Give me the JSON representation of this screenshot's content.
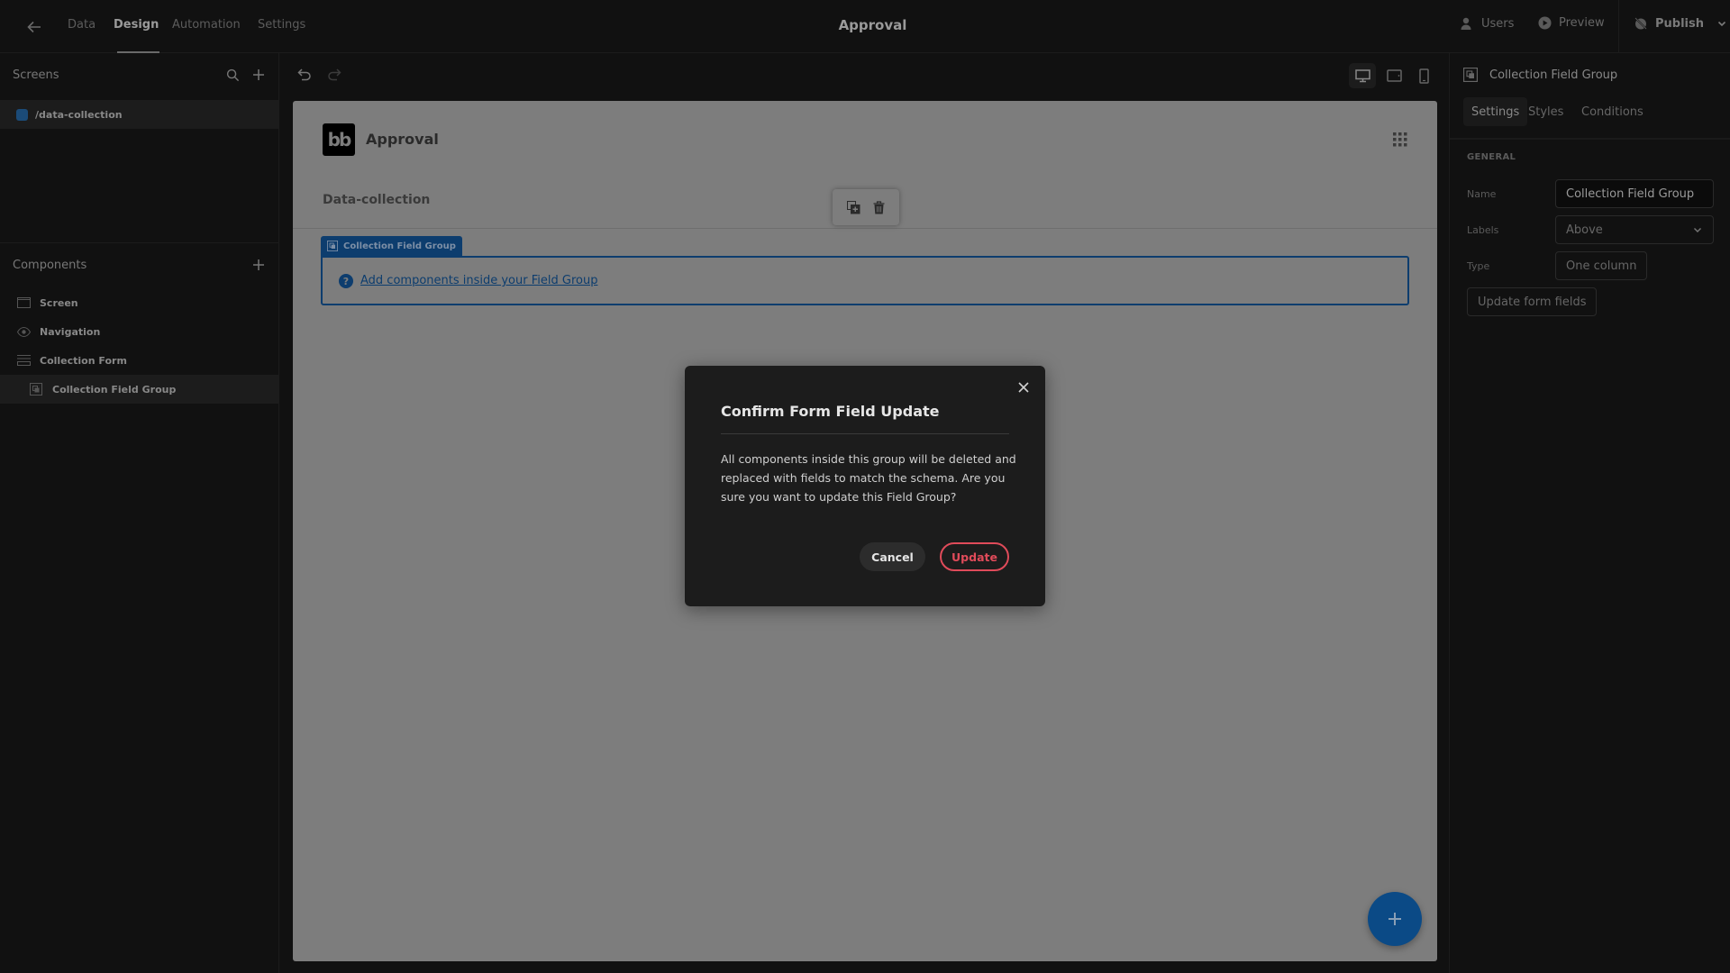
{
  "topbar": {
    "back_icon": "arrow-left-icon",
    "tabs": [
      {
        "label": "Data",
        "active": false
      },
      {
        "label": "Design",
        "active": true
      },
      {
        "label": "Automation",
        "active": false
      },
      {
        "label": "Settings",
        "active": false
      }
    ],
    "app_title": "Approval",
    "actions": {
      "users": "Users",
      "preview": "Preview",
      "publish": "Publish"
    }
  },
  "left_panel": {
    "screens_heading": "Screens",
    "screens": [
      {
        "label": "/data-collection",
        "color": "#1b4b78"
      }
    ],
    "components_heading": "Components",
    "components": [
      {
        "label": "Screen",
        "icon": "screen-icon"
      },
      {
        "label": "Navigation",
        "icon": "eye-icon"
      },
      {
        "label": "Collection Form",
        "icon": "form-icon"
      },
      {
        "label": "Collection Field Group",
        "icon": "field-group-icon",
        "selected": true
      }
    ]
  },
  "toolbar": {
    "undo_icon": "undo-icon",
    "redo_icon": "redo-icon",
    "devices": [
      "desktop",
      "tablet",
      "mobile"
    ],
    "active_device": "desktop"
  },
  "canvas": {
    "logo_text": "bb",
    "app_name": "Approval",
    "page_heading": "Data-collection",
    "field_group_tag": "Collection Field Group",
    "field_group_link": "Add components inside your Field Group",
    "accent_color": "#0d3d6e"
  },
  "right_panel": {
    "title": "Collection Field Group",
    "tabs": [
      {
        "label": "Settings",
        "active": true
      },
      {
        "label": "Styles",
        "active": false
      },
      {
        "label": "Conditions",
        "active": false
      }
    ],
    "section": "GENERAL",
    "fields": {
      "name_label": "Name",
      "name_value": "Collection Field Group",
      "labels_label": "Labels",
      "labels_value": "Above",
      "type_label": "Type",
      "type_value": "One column"
    },
    "update_button": "Update form fields"
  },
  "modal": {
    "title": "Confirm Form Field Update",
    "body": "All components inside this group will be deleted and replaced with fields to match the schema. Are you sure you want to update this Field Group?",
    "cancel": "Cancel",
    "confirm": "Update",
    "confirm_color": "#e04b5a"
  }
}
